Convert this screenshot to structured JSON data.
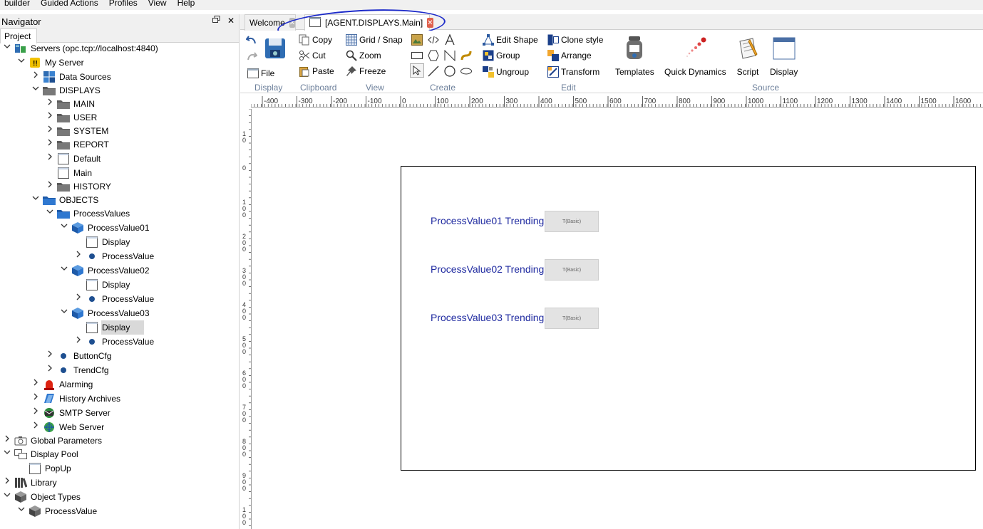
{
  "menu": [
    "builder",
    "Guided Actions",
    "Profiles",
    "View",
    "Help"
  ],
  "navigator": {
    "title": "Navigator",
    "restore_icon": "restore-icon",
    "close_glyph": "✕",
    "tab": "Project",
    "tree": [
      {
        "label": "Servers (opc.tcp://localhost:4840)",
        "icon": "servers-icon"
      },
      {
        "label": "My Server",
        "icon": "server-icon"
      },
      {
        "label": "Data Sources",
        "icon": "datasources-icon"
      },
      {
        "label": "DISPLAYS",
        "icon": "folder-dark-icon"
      },
      {
        "label": "MAIN",
        "icon": "folder-dark-icon"
      },
      {
        "label": "USER",
        "icon": "folder-dark-icon"
      },
      {
        "label": "SYSTEM",
        "icon": "folder-dark-icon"
      },
      {
        "label": "REPORT",
        "icon": "folder-dark-icon"
      },
      {
        "label": "Default",
        "icon": "display-icon"
      },
      {
        "label": "Main",
        "icon": "display-icon"
      },
      {
        "label": "HISTORY",
        "icon": "folder-dark-icon"
      },
      {
        "label": "OBJECTS",
        "icon": "folder-blue-icon"
      },
      {
        "label": "ProcessValues",
        "icon": "folder-blue-icon"
      },
      {
        "label": "ProcessValue01",
        "icon": "cube-icon"
      },
      {
        "label": "Display",
        "icon": "display-icon"
      },
      {
        "label": "ProcessValue",
        "icon": "dot-icon"
      },
      {
        "label": "ProcessValue02",
        "icon": "cube-icon"
      },
      {
        "label": "Display",
        "icon": "display-icon"
      },
      {
        "label": "ProcessValue",
        "icon": "dot-icon"
      },
      {
        "label": "ProcessValue03",
        "icon": "cube-icon"
      },
      {
        "label": "Display",
        "icon": "display-icon"
      },
      {
        "label": "ProcessValue",
        "icon": "dot-icon"
      },
      {
        "label": "ButtonCfg",
        "icon": "dot-icon"
      },
      {
        "label": "TrendCfg",
        "icon": "dot-icon"
      },
      {
        "label": "Alarming",
        "icon": "alarm-icon"
      },
      {
        "label": "History Archives",
        "icon": "archive-icon"
      },
      {
        "label": "SMTP Server",
        "icon": "smtp-icon"
      },
      {
        "label": "Web Server",
        "icon": "webserver-icon"
      },
      {
        "label": "Global Parameters",
        "icon": "camera-icon"
      },
      {
        "label": "Display Pool",
        "icon": "displaypool-icon"
      },
      {
        "label": "PopUp",
        "icon": "display-icon"
      },
      {
        "label": "Library",
        "icon": "library-icon"
      },
      {
        "label": "Object Types",
        "icon": "cube-dark-icon"
      },
      {
        "label": "ProcessValue",
        "icon": "cube-dark-icon"
      }
    ]
  },
  "tabs": [
    {
      "label": "Welcome",
      "close_icon": "close-gray-icon"
    },
    {
      "label": "[AGENT.DISPLAYS.Main]",
      "close_icon": "close-red-icon"
    }
  ],
  "ribbon": {
    "display": {
      "file": "File",
      "group": "Display"
    },
    "clipboard": {
      "copy": "Copy",
      "cut": "Cut",
      "paste": "Paste",
      "group": "Clipboard"
    },
    "view": {
      "grid": "Grid / Snap",
      "zoom": "Zoom",
      "freeze": "Freeze",
      "group": "View"
    },
    "create": {
      "group": "Create"
    },
    "edit": {
      "edit_shape": "Edit Shape",
      "group_btn": "Group",
      "ungroup": "Ungroup",
      "clone": "Clone style",
      "arrange": "Arrange",
      "transform": "Transform",
      "group": "Edit"
    },
    "source": {
      "templates": "Templates",
      "quick": "Quick Dynamics",
      "script": "Script",
      "display": "Display",
      "group": "Source"
    }
  },
  "ruler": {
    "h_labels": [
      "-400",
      "-300",
      "-200",
      "-100",
      "0",
      "100",
      "200",
      "300",
      "400",
      "500",
      "600",
      "700",
      "800",
      "900",
      "1000",
      "1100",
      "1200",
      "1300",
      "1400",
      "1500",
      "1600"
    ],
    "v_labels": [
      "1\n0",
      "0",
      "1\n0\n0",
      "2\n0\n0",
      "3\n0\n0",
      "4\n0\n0",
      "5\n0\n0",
      "6\n0\n0",
      "7\n0\n0",
      "8\n0\n0",
      "9\n0\n0",
      "1\n0\n0"
    ]
  },
  "canvas": {
    "trends": [
      {
        "label": "ProcessValue01 Trending",
        "button": "T(Basic)"
      },
      {
        "label": "ProcessValue02 Trending",
        "button": "T(Basic)"
      },
      {
        "label": "ProcessValue03 Trending",
        "button": "T(Basic)"
      }
    ]
  }
}
